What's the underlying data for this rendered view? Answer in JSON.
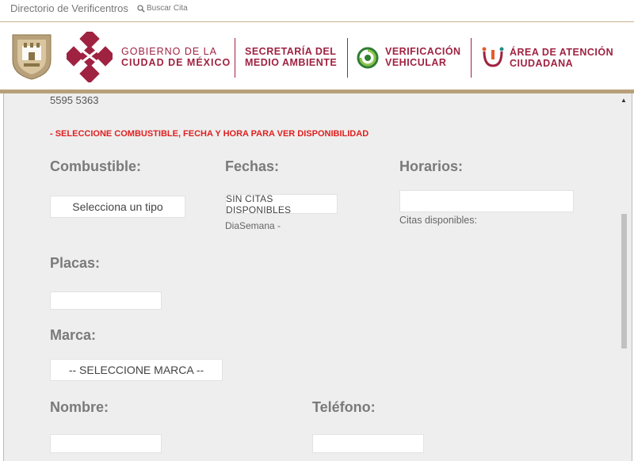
{
  "topnav": {
    "directory_link": "Directorio de Verificentros",
    "search_link": "Buscar Cita",
    "search_icon": "search-icon"
  },
  "header": {
    "gov_line1": "GOBIERNO DE LA",
    "gov_line2": "CIUDAD DE MÉXICO",
    "sedema_line1": "SECRETARÍA DEL",
    "sedema_line2": "MEDIO AMBIENTE",
    "verif_line1": "VERIFICACIÓN",
    "verif_line2": "VEHICULAR",
    "aac_line1": "ÁREA DE ATENCIÓN",
    "aac_line2": "CIUDADANA",
    "brand_color": "#9f2241",
    "gold_color": "#b8a07a"
  },
  "form": {
    "phone": "5595 5363",
    "warning": "- SELECCIONE COMBUSTIBLE, FECHA Y HORA PARA VER DISPONIBILIDAD",
    "fuel_label": "Combustible:",
    "fuel_select": "Selecciona un tipo",
    "dates_label": "Fechas:",
    "dates_select": "SIN CITAS DISPONIBLES",
    "weekday_text": "DiaSemana -",
    "hours_label": "Horarios:",
    "hours_value": "",
    "available_text": "Citas disponibles:",
    "plates_label": "Placas:",
    "plates_value": "",
    "brand_label": "Marca:",
    "brand_select": "-- SELECCIONE MARCA --",
    "name_label": "Nombre:",
    "name_value": "",
    "phone_label": "Teléfono:",
    "phone_value": "",
    "warning_color": "#e02020"
  }
}
